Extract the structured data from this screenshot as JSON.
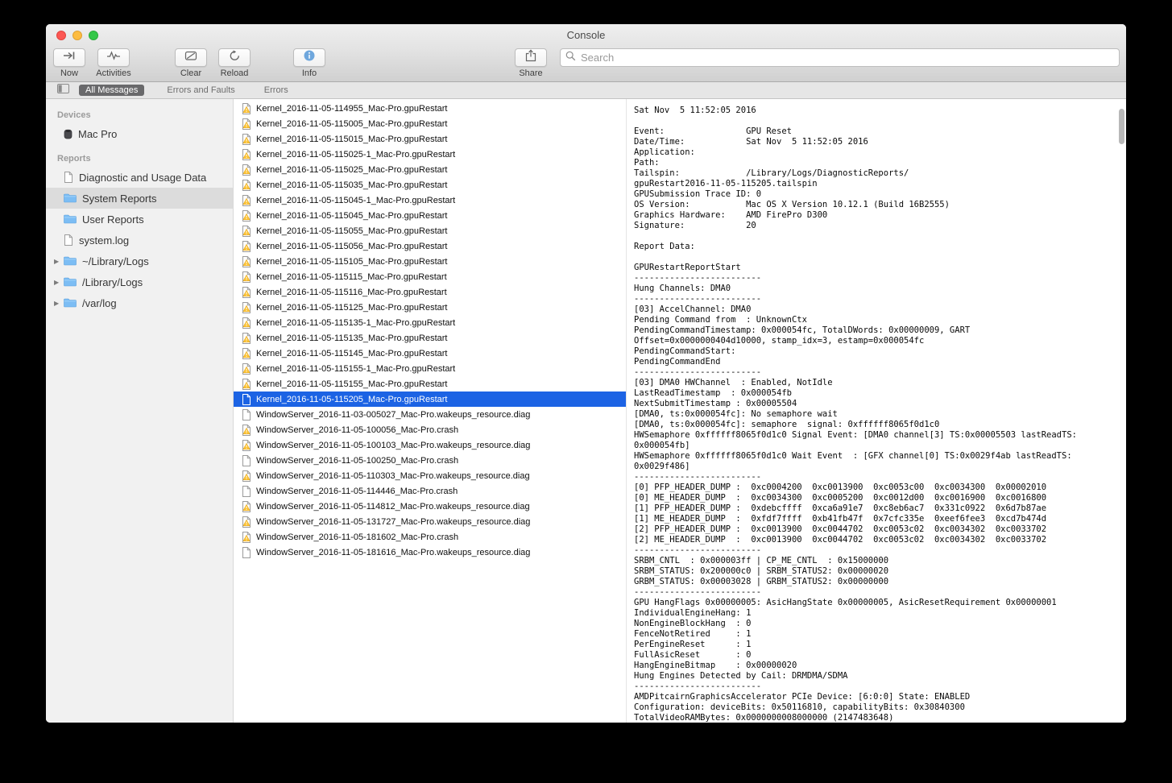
{
  "window": {
    "title": "Console"
  },
  "toolbar": {
    "buttons": [
      {
        "label": "Now",
        "icon": "now-icon"
      },
      {
        "label": "Activities",
        "icon": "activities-icon"
      },
      {
        "label": "Clear",
        "icon": "clear-icon"
      },
      {
        "label": "Reload",
        "icon": "reload-icon"
      },
      {
        "label": "Info",
        "icon": "info-icon"
      },
      {
        "label": "Share",
        "icon": "share-icon"
      }
    ],
    "search": {
      "placeholder": "Search"
    }
  },
  "filterbar": {
    "tabs": [
      {
        "label": "All Messages",
        "selected": true
      },
      {
        "label": "Errors and Faults",
        "selected": false
      },
      {
        "label": "Errors",
        "selected": false
      }
    ]
  },
  "sidebar": {
    "sections": [
      {
        "header": "Devices",
        "items": [
          {
            "label": "Mac Pro",
            "icon": "device",
            "selected": false,
            "disclosure": false
          }
        ]
      },
      {
        "header": "Reports",
        "items": [
          {
            "label": "Diagnostic and Usage Data",
            "icon": "doc",
            "selected": false,
            "disclosure": false
          },
          {
            "label": "System Reports",
            "icon": "folder",
            "selected": true,
            "disclosure": false
          },
          {
            "label": "User Reports",
            "icon": "folder",
            "selected": false,
            "disclosure": false
          },
          {
            "label": "system.log",
            "icon": "doc",
            "selected": false,
            "disclosure": false
          },
          {
            "label": "~/Library/Logs",
            "icon": "folder",
            "selected": false,
            "disclosure": true
          },
          {
            "label": "/Library/Logs",
            "icon": "folder",
            "selected": false,
            "disclosure": true
          },
          {
            "label": "/var/log",
            "icon": "folder",
            "selected": false,
            "disclosure": true
          }
        ]
      }
    ]
  },
  "filelist": {
    "items": [
      {
        "name": "Kernel_2016-11-05-114955_Mac-Pro.gpuRestart",
        "icon": "warning",
        "selected": false
      },
      {
        "name": "Kernel_2016-11-05-115005_Mac-Pro.gpuRestart",
        "icon": "warning",
        "selected": false
      },
      {
        "name": "Kernel_2016-11-05-115015_Mac-Pro.gpuRestart",
        "icon": "warning",
        "selected": false
      },
      {
        "name": "Kernel_2016-11-05-115025-1_Mac-Pro.gpuRestart",
        "icon": "warning",
        "selected": false
      },
      {
        "name": "Kernel_2016-11-05-115025_Mac-Pro.gpuRestart",
        "icon": "warning",
        "selected": false
      },
      {
        "name": "Kernel_2016-11-05-115035_Mac-Pro.gpuRestart",
        "icon": "warning",
        "selected": false
      },
      {
        "name": "Kernel_2016-11-05-115045-1_Mac-Pro.gpuRestart",
        "icon": "warning",
        "selected": false
      },
      {
        "name": "Kernel_2016-11-05-115045_Mac-Pro.gpuRestart",
        "icon": "warning",
        "selected": false
      },
      {
        "name": "Kernel_2016-11-05-115055_Mac-Pro.gpuRestart",
        "icon": "warning",
        "selected": false
      },
      {
        "name": "Kernel_2016-11-05-115056_Mac-Pro.gpuRestart",
        "icon": "warning",
        "selected": false
      },
      {
        "name": "Kernel_2016-11-05-115105_Mac-Pro.gpuRestart",
        "icon": "warning",
        "selected": false
      },
      {
        "name": "Kernel_2016-11-05-115115_Mac-Pro.gpuRestart",
        "icon": "warning",
        "selected": false
      },
      {
        "name": "Kernel_2016-11-05-115116_Mac-Pro.gpuRestart",
        "icon": "warning",
        "selected": false
      },
      {
        "name": "Kernel_2016-11-05-115125_Mac-Pro.gpuRestart",
        "icon": "warning",
        "selected": false
      },
      {
        "name": "Kernel_2016-11-05-115135-1_Mac-Pro.gpuRestart",
        "icon": "warning",
        "selected": false
      },
      {
        "name": "Kernel_2016-11-05-115135_Mac-Pro.gpuRestart",
        "icon": "warning",
        "selected": false
      },
      {
        "name": "Kernel_2016-11-05-115145_Mac-Pro.gpuRestart",
        "icon": "warning",
        "selected": false
      },
      {
        "name": "Kernel_2016-11-05-115155-1_Mac-Pro.gpuRestart",
        "icon": "warning",
        "selected": false
      },
      {
        "name": "Kernel_2016-11-05-115155_Mac-Pro.gpuRestart",
        "icon": "warning",
        "selected": false
      },
      {
        "name": "Kernel_2016-11-05-115205_Mac-Pro.gpuRestart",
        "icon": "doc",
        "selected": true
      },
      {
        "name": "WindowServer_2016-11-03-005027_Mac-Pro.wakeups_resource.diag",
        "icon": "doc",
        "selected": false
      },
      {
        "name": "WindowServer_2016-11-05-100056_Mac-Pro.crash",
        "icon": "warning",
        "selected": false
      },
      {
        "name": "WindowServer_2016-11-05-100103_Mac-Pro.wakeups_resource.diag",
        "icon": "warning",
        "selected": false
      },
      {
        "name": "WindowServer_2016-11-05-100250_Mac-Pro.crash",
        "icon": "doc",
        "selected": false
      },
      {
        "name": "WindowServer_2016-11-05-110303_Mac-Pro.wakeups_resource.diag",
        "icon": "warning",
        "selected": false
      },
      {
        "name": "WindowServer_2016-11-05-114446_Mac-Pro.crash",
        "icon": "doc",
        "selected": false
      },
      {
        "name": "WindowServer_2016-11-05-114812_Mac-Pro.wakeups_resource.diag",
        "icon": "warning",
        "selected": false
      },
      {
        "name": "WindowServer_2016-11-05-131727_Mac-Pro.wakeups_resource.diag",
        "icon": "warning",
        "selected": false
      },
      {
        "name": "WindowServer_2016-11-05-181602_Mac-Pro.crash",
        "icon": "warning",
        "selected": false
      },
      {
        "name": "WindowServer_2016-11-05-181616_Mac-Pro.wakeups_resource.diag",
        "icon": "doc",
        "selected": false
      }
    ]
  },
  "log": {
    "lines": [
      "Sat Nov  5 11:52:05 2016",
      "",
      "Event:                GPU Reset",
      "Date/Time:            Sat Nov  5 11:52:05 2016",
      "Application:",
      "Path:",
      "Tailspin:             /Library/Logs/DiagnosticReports/",
      "gpuRestart2016-11-05-115205.tailspin",
      "GPUSubmission Trace ID: 0",
      "OS Version:           Mac OS X Version 10.12.1 (Build 16B2555)",
      "Graphics Hardware:    AMD FirePro D300",
      "Signature:            20",
      "",
      "Report Data:",
      "",
      "GPURestartReportStart",
      "-------------------------",
      "Hung Channels: DMA0",
      "-------------------------",
      "[03] AccelChannel: DMA0",
      "Pending Command from  : UnknownCtx",
      "PendingCommandTimestamp: 0x000054fc, TotalDWords: 0x00000009, GART",
      "Offset=0x0000000404d10000, stamp_idx=3, estamp=0x000054fc",
      "PendingCommandStart:",
      "PendingCommandEnd",
      "-------------------------",
      "[03] DMA0 HWChannel  : Enabled, NotIdle",
      "LastReadTimestamp  : 0x000054fb",
      "NextSubmitTimestamp : 0x00005504",
      "[DMA0, ts:0x000054fc]: No semaphore wait",
      "[DMA0, ts:0x000054fc]: semaphore  signal: 0xffffff8065f0d1c0",
      "HWSemaphore 0xffffff8065f0d1c0 Signal Event: [DMA0 channel[3] TS:0x00005503 lastReadTS:",
      "0x000054fb]",
      "HWSemaphore 0xffffff8065f0d1c0 Wait Event  : [GFX channel[0] TS:0x0029f4ab lastReadTS:",
      "0x0029f486]",
      "-------------------------",
      "[0] PFP_HEADER_DUMP :  0xc0004200  0xc0013900  0xc0053c00  0xc0034300  0x00002010",
      "[0] ME_HEADER_DUMP  :  0xc0034300  0xc0005200  0xc0012d00  0xc0016900  0xc0016800",
      "[1] PFP_HEADER_DUMP :  0xdebcffff  0xca6a91e7  0xc8eb6ac7  0x331c0922  0x6d7b87ae",
      "[1] ME_HEADER_DUMP  :  0xfdf7ffff  0xb41fb47f  0x7cfc335e  0xeef6fee3  0xcd7b474d",
      "[2] PFP_HEADER_DUMP :  0xc0013900  0xc0044702  0xc0053c02  0xc0034302  0xc0033702",
      "[2] ME_HEADER_DUMP  :  0xc0013900  0xc0044702  0xc0053c02  0xc0034302  0xc0033702",
      "-------------------------",
      "SRBM_CNTL  : 0x000003ff | CP_ME_CNTL  : 0x15000000",
      "SRBM_STATUS: 0x200000c0 | SRBM_STATUS2: 0x00000020",
      "GRBM_STATUS: 0x00003028 | GRBM_STATUS2: 0x00000000",
      "-------------------------",
      "GPU HangFlags 0x00000005: AsicHangState 0x00000005, AsicResetRequirement 0x00000001",
      "IndividualEngineHang: 1",
      "NonEngineBlockHang  : 0",
      "FenceNotRetired     : 1",
      "PerEngineReset      : 1",
      "FullAsicReset       : 0",
      "HangEngineBitmap    : 0x00000020",
      "Hung Engines Detected by Cail: DRMDMA/SDMA",
      "-------------------------",
      "AMDPitcairnGraphicsAccelerator PCIe Device: [6:0:0] State: ENABLED",
      "Configuration: deviceBits: 0x50116810, capabilityBits: 0x30840300",
      "TotalVideoRAMBytes: 0x0000000008000000 (2147483648)"
    ]
  },
  "colors": {
    "selection_blue": "#1c63e4",
    "warning_yellow": "#fdc12f",
    "folder_blue": "#7cbdf4"
  }
}
